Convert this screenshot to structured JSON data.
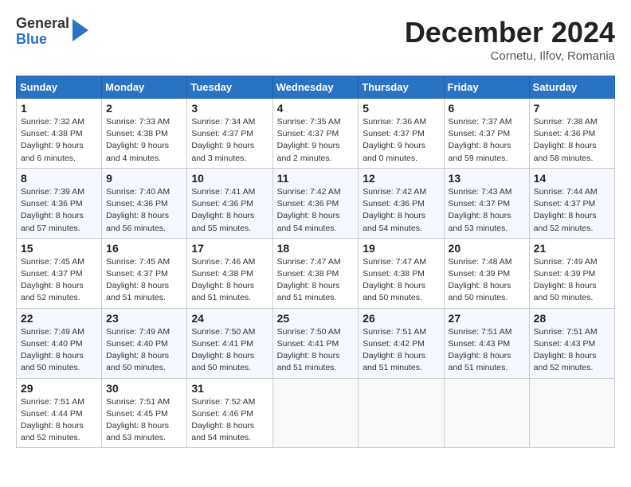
{
  "header": {
    "logo_general": "General",
    "logo_blue": "Blue",
    "month_title": "December 2024",
    "location": "Cornetu, Ilfov, Romania"
  },
  "days_of_week": [
    "Sunday",
    "Monday",
    "Tuesday",
    "Wednesday",
    "Thursday",
    "Friday",
    "Saturday"
  ],
  "weeks": [
    [
      {
        "day": "1",
        "sunrise": "7:32 AM",
        "sunset": "4:38 PM",
        "daylight": "9 hours and 6 minutes."
      },
      {
        "day": "2",
        "sunrise": "7:33 AM",
        "sunset": "4:38 PM",
        "daylight": "9 hours and 4 minutes."
      },
      {
        "day": "3",
        "sunrise": "7:34 AM",
        "sunset": "4:37 PM",
        "daylight": "9 hours and 3 minutes."
      },
      {
        "day": "4",
        "sunrise": "7:35 AM",
        "sunset": "4:37 PM",
        "daylight": "9 hours and 2 minutes."
      },
      {
        "day": "5",
        "sunrise": "7:36 AM",
        "sunset": "4:37 PM",
        "daylight": "9 hours and 0 minutes."
      },
      {
        "day": "6",
        "sunrise": "7:37 AM",
        "sunset": "4:37 PM",
        "daylight": "8 hours and 59 minutes."
      },
      {
        "day": "7",
        "sunrise": "7:38 AM",
        "sunset": "4:36 PM",
        "daylight": "8 hours and 58 minutes."
      }
    ],
    [
      {
        "day": "8",
        "sunrise": "7:39 AM",
        "sunset": "4:36 PM",
        "daylight": "8 hours and 57 minutes."
      },
      {
        "day": "9",
        "sunrise": "7:40 AM",
        "sunset": "4:36 PM",
        "daylight": "8 hours and 56 minutes."
      },
      {
        "day": "10",
        "sunrise": "7:41 AM",
        "sunset": "4:36 PM",
        "daylight": "8 hours and 55 minutes."
      },
      {
        "day": "11",
        "sunrise": "7:42 AM",
        "sunset": "4:36 PM",
        "daylight": "8 hours and 54 minutes."
      },
      {
        "day": "12",
        "sunrise": "7:42 AM",
        "sunset": "4:36 PM",
        "daylight": "8 hours and 54 minutes."
      },
      {
        "day": "13",
        "sunrise": "7:43 AM",
        "sunset": "4:37 PM",
        "daylight": "8 hours and 53 minutes."
      },
      {
        "day": "14",
        "sunrise": "7:44 AM",
        "sunset": "4:37 PM",
        "daylight": "8 hours and 52 minutes."
      }
    ],
    [
      {
        "day": "15",
        "sunrise": "7:45 AM",
        "sunset": "4:37 PM",
        "daylight": "8 hours and 52 minutes."
      },
      {
        "day": "16",
        "sunrise": "7:45 AM",
        "sunset": "4:37 PM",
        "daylight": "8 hours and 51 minutes."
      },
      {
        "day": "17",
        "sunrise": "7:46 AM",
        "sunset": "4:38 PM",
        "daylight": "8 hours and 51 minutes."
      },
      {
        "day": "18",
        "sunrise": "7:47 AM",
        "sunset": "4:38 PM",
        "daylight": "8 hours and 51 minutes."
      },
      {
        "day": "19",
        "sunrise": "7:47 AM",
        "sunset": "4:38 PM",
        "daylight": "8 hours and 50 minutes."
      },
      {
        "day": "20",
        "sunrise": "7:48 AM",
        "sunset": "4:39 PM",
        "daylight": "8 hours and 50 minutes."
      },
      {
        "day": "21",
        "sunrise": "7:49 AM",
        "sunset": "4:39 PM",
        "daylight": "8 hours and 50 minutes."
      }
    ],
    [
      {
        "day": "22",
        "sunrise": "7:49 AM",
        "sunset": "4:40 PM",
        "daylight": "8 hours and 50 minutes."
      },
      {
        "day": "23",
        "sunrise": "7:49 AM",
        "sunset": "4:40 PM",
        "daylight": "8 hours and 50 minutes."
      },
      {
        "day": "24",
        "sunrise": "7:50 AM",
        "sunset": "4:41 PM",
        "daylight": "8 hours and 50 minutes."
      },
      {
        "day": "25",
        "sunrise": "7:50 AM",
        "sunset": "4:41 PM",
        "daylight": "8 hours and 51 minutes."
      },
      {
        "day": "26",
        "sunrise": "7:51 AM",
        "sunset": "4:42 PM",
        "daylight": "8 hours and 51 minutes."
      },
      {
        "day": "27",
        "sunrise": "7:51 AM",
        "sunset": "4:43 PM",
        "daylight": "8 hours and 51 minutes."
      },
      {
        "day": "28",
        "sunrise": "7:51 AM",
        "sunset": "4:43 PM",
        "daylight": "8 hours and 52 minutes."
      }
    ],
    [
      {
        "day": "29",
        "sunrise": "7:51 AM",
        "sunset": "4:44 PM",
        "daylight": "8 hours and 52 minutes."
      },
      {
        "day": "30",
        "sunrise": "7:51 AM",
        "sunset": "4:45 PM",
        "daylight": "8 hours and 53 minutes."
      },
      {
        "day": "31",
        "sunrise": "7:52 AM",
        "sunset": "4:46 PM",
        "daylight": "8 hours and 54 minutes."
      },
      null,
      null,
      null,
      null
    ]
  ],
  "labels": {
    "sunrise_prefix": "Sunrise: ",
    "sunset_prefix": "Sunset: ",
    "daylight_prefix": "Daylight: "
  }
}
